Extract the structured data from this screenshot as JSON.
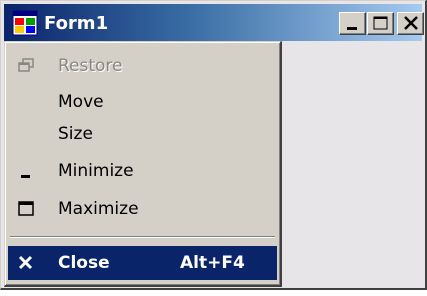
{
  "window": {
    "title": "Form1",
    "title_icon": "app-icon",
    "controls": [
      {
        "name": "minimize-button",
        "icon": "minimize-icon"
      },
      {
        "name": "maximize-button",
        "icon": "maximize-icon"
      },
      {
        "name": "close-button",
        "icon": "close-icon"
      }
    ]
  },
  "system_menu": {
    "items": [
      {
        "label": "Restore",
        "icon": "restore-icon",
        "enabled": false,
        "shortcut": ""
      },
      {
        "label": "Move",
        "icon": "",
        "enabled": true,
        "shortcut": ""
      },
      {
        "label": "Size",
        "icon": "",
        "enabled": true,
        "shortcut": ""
      },
      {
        "label": "Minimize",
        "icon": "minimize-icon",
        "enabled": true,
        "shortcut": ""
      },
      {
        "label": "Maximize",
        "icon": "maximize-icon",
        "enabled": true,
        "shortcut": ""
      },
      {
        "label": "Close",
        "icon": "close-icon",
        "enabled": true,
        "shortcut": "Alt+F4",
        "selected": true
      }
    ]
  },
  "colors": {
    "title_gradient_start": "#0a246a",
    "title_gradient_end": "#a6caf0",
    "menu_background": "#d4d0c8",
    "selection": "#0a246a",
    "disabled_text": "#8a8780",
    "client_area": "#e8e5e9"
  }
}
